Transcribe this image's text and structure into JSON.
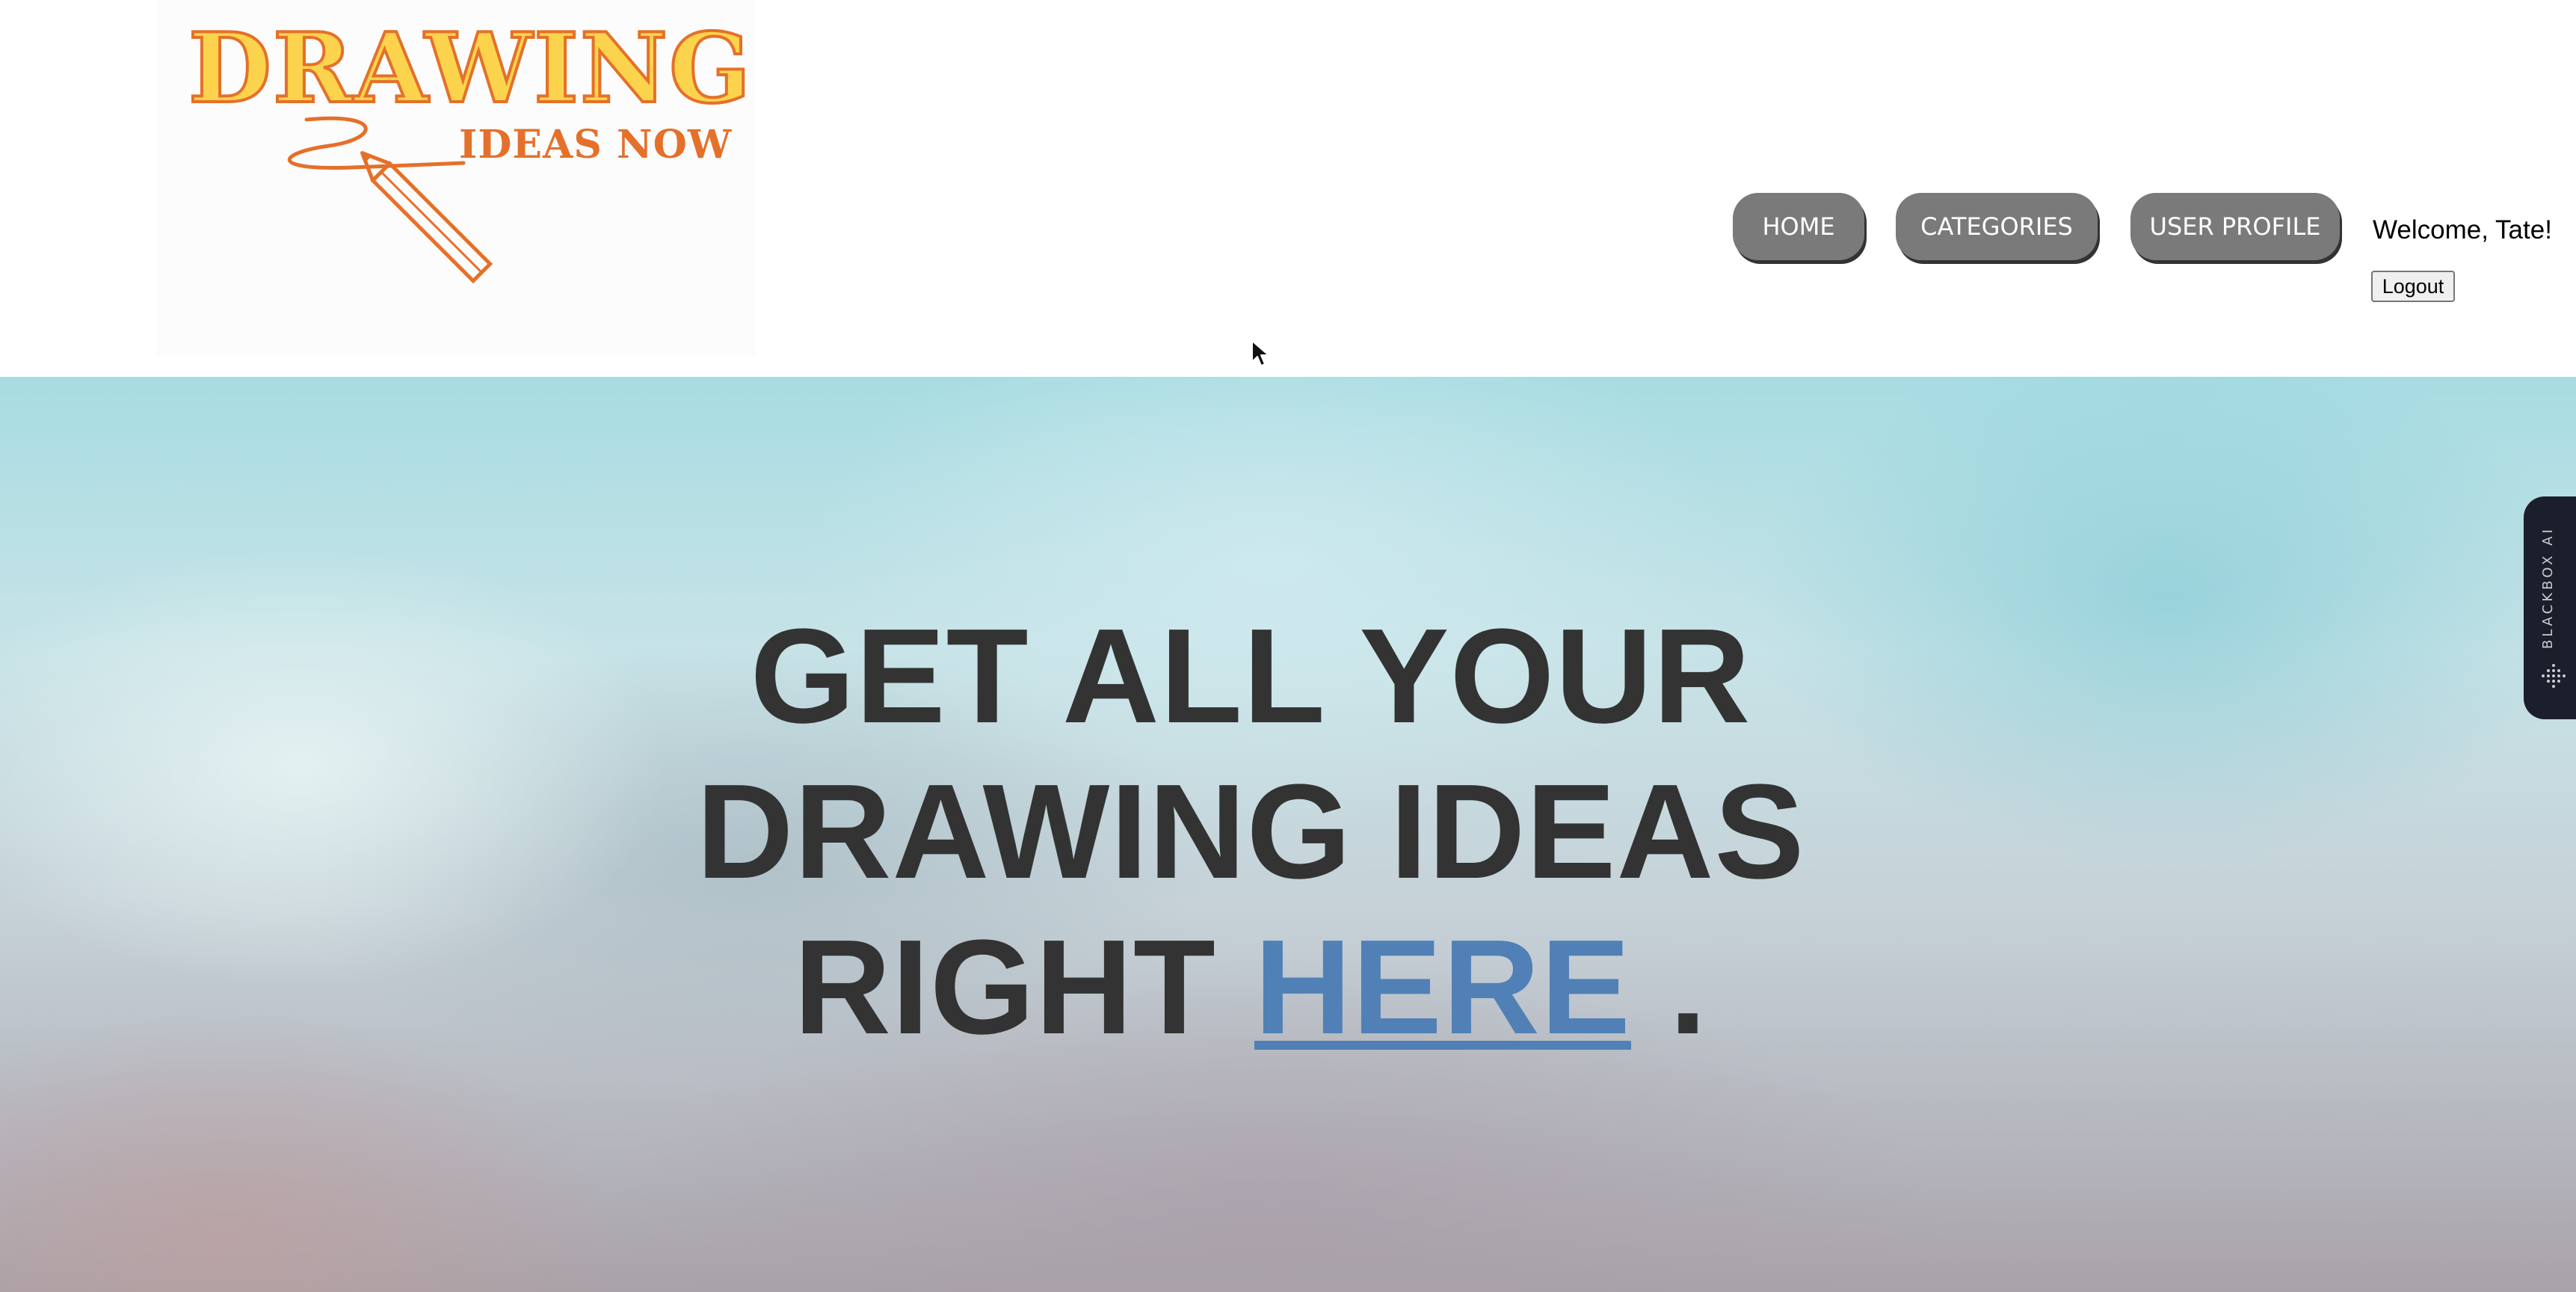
{
  "logo": {
    "title": "DRAWING",
    "subtitle": "IDEAS NOW"
  },
  "nav": {
    "home": "HOME",
    "categories": "CATEGORIES",
    "user_profile": "USER PROFILE"
  },
  "user": {
    "welcome": "Welcome, Tate!",
    "logout": "Logout"
  },
  "hero": {
    "line1": "GET ALL YOUR",
    "line2": "DRAWING IDEAS",
    "line3_prefix": "RIGHT ",
    "link": "HERE",
    "line3_suffix": " ."
  },
  "side_widget": {
    "label": "BLACKBOX AI",
    "icon": "dot-grid-icon"
  },
  "colors": {
    "logo_yellow": "#fcd34d",
    "logo_orange": "#e5702a",
    "nav_button": "#7a7a7a",
    "hero_text": "#333333",
    "hero_link": "#5080b6",
    "widget_bg": "#1a1f2b"
  },
  "icons": {
    "pencil": "pencil-icon",
    "cursor": "mouse-cursor-icon"
  }
}
